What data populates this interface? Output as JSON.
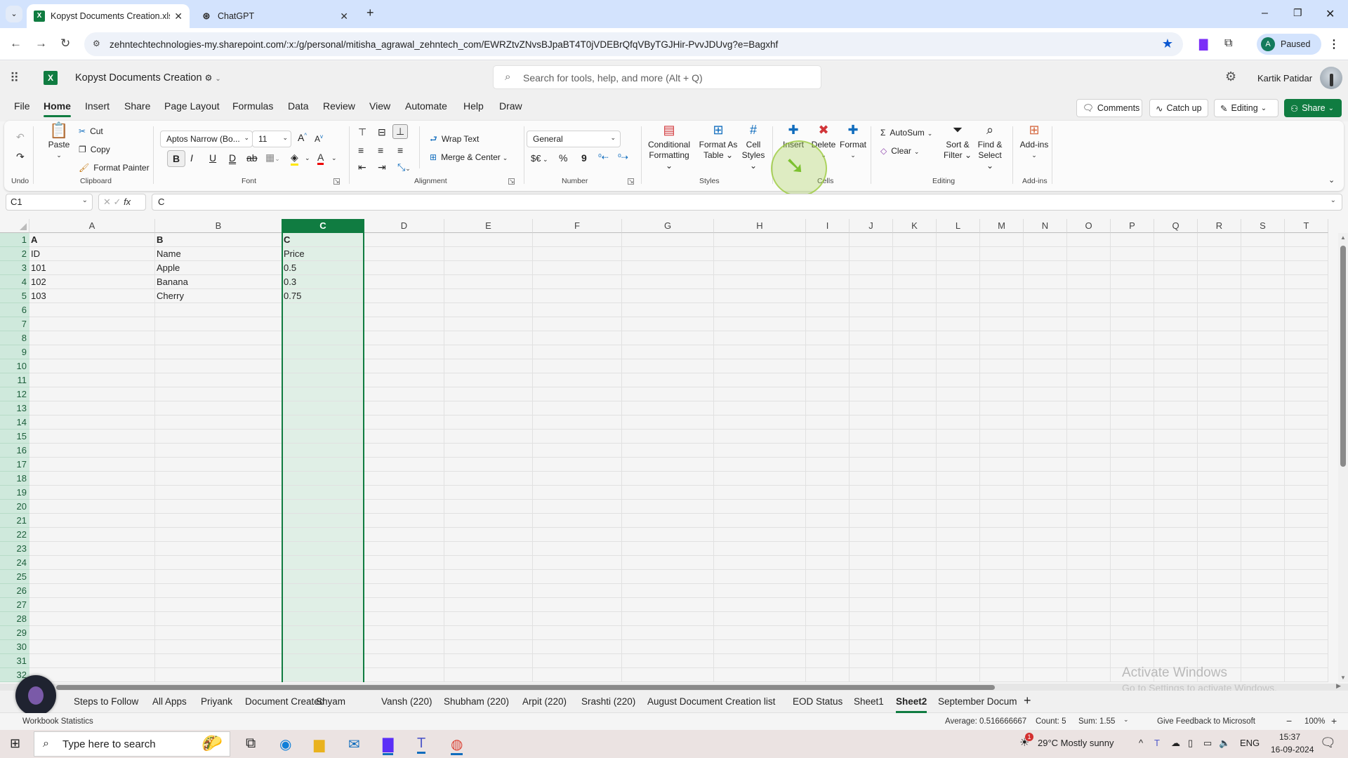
{
  "browser": {
    "tabs": [
      {
        "title": "Kopyst Documents Creation.xlsx",
        "active": true,
        "icon": "excel-icon"
      },
      {
        "title": "ChatGPT",
        "active": false,
        "icon": "chatgpt-icon"
      }
    ],
    "new_tab": "+",
    "url": "zehntechtechnologies-my.sharepoint.com/:x:/g/personal/mitisha_agrawal_zehntech_com/EWRZtvZNvsBJpaBT4T0jVDEBrQfqVByTGJHir-PvvJDUvg?e=Bagxhf",
    "profile_initial": "A",
    "profile_status": "Paused",
    "window_controls": {
      "minimize": "–",
      "restore": "❐",
      "close": "✕"
    }
  },
  "app": {
    "doc_title": "Kopyst Documents Creation",
    "search_placeholder": "Search for tools, help, and more (Alt + Q)",
    "user_name": "Kartik Patidar"
  },
  "menu": {
    "tabs": [
      "File",
      "Home",
      "Insert",
      "Share",
      "Page Layout",
      "Formulas",
      "Data",
      "Review",
      "View",
      "Automate",
      "Help",
      "Draw"
    ],
    "active": "Home",
    "comments": "Comments",
    "catch_up": "Catch up",
    "editing": "Editing",
    "share": "Share"
  },
  "ribbon": {
    "undo_group": "Undo",
    "clipboard": {
      "paste": "Paste",
      "cut": "Cut",
      "copy": "Copy",
      "format_painter": "Format Painter",
      "label": "Clipboard"
    },
    "font": {
      "name": "Aptos Narrow (Bo...",
      "size": "11",
      "label": "Font",
      "bold": "B",
      "italic": "I",
      "underline": "U",
      "double_underline": "D"
    },
    "alignment": {
      "wrap_text": "Wrap Text",
      "merge_center": "Merge & Center",
      "label": "Alignment"
    },
    "number": {
      "format": "General",
      "currency": "$€",
      "percent": "%",
      "comma": "9",
      "label": "Number"
    },
    "styles": {
      "conditional_1": "Conditional",
      "conditional_2": "Formatting",
      "format_table_1": "Format As",
      "format_table_2": "Table",
      "cell_styles_1": "Cell",
      "cell_styles_2": "Styles",
      "label": "Styles"
    },
    "cells": {
      "insert": "Insert",
      "delete": "Delete",
      "format": "Format",
      "label": "Cells"
    },
    "editing": {
      "autosum": "AutoSum",
      "clear": "Clear",
      "sort_1": "Sort &",
      "sort_2": "Filter",
      "find_1": "Find &",
      "find_2": "Select",
      "label": "Editing"
    },
    "addins": {
      "button": "Add-ins",
      "label": "Add-ins"
    }
  },
  "formula_bar": {
    "name_box": "C1",
    "fx": "fx",
    "content": "C"
  },
  "sheet": {
    "columns": [
      "A",
      "B",
      "C",
      "D",
      "E",
      "F",
      "G",
      "H",
      "I",
      "J",
      "K",
      "L",
      "M",
      "N",
      "O",
      "P",
      "Q",
      "R",
      "S",
      "T"
    ],
    "selected_column": "C",
    "row_count": 32,
    "rows": [
      [
        "A",
        "B",
        "C"
      ],
      [
        "ID",
        "Name",
        "Price"
      ],
      [
        "101",
        "Apple",
        "0.5"
      ],
      [
        "102",
        "Banana",
        "0.3"
      ],
      [
        "103",
        "Cherry",
        "0.75"
      ]
    ]
  },
  "sheet_tabs": [
    "Steps to Follow",
    "All Apps",
    "Priyank",
    "Document Created",
    "Shyam",
    "Vansh (220)",
    "Shubham (220)",
    "Arpit (220)",
    "Srashti (220)",
    "August Document Creation list",
    "EOD Status",
    "Sheet1",
    "Sheet2",
    "September Docum"
  ],
  "active_sheet": "Sheet2",
  "status_bar": {
    "left": "Workbook Statistics",
    "average": "Average: 0.516666667",
    "count": "Count: 5",
    "sum": "Sum: 1.55",
    "feedback": "Give Feedback to Microsoft",
    "zoom": "100%"
  },
  "watermark": {
    "line1": "Activate Windows",
    "line2": "Go to Settings to activate Windows."
  },
  "taskbar": {
    "search_placeholder": "Type here to search",
    "weather": "29°C  Mostly sunny",
    "weather_badge": "1",
    "lang": "ENG",
    "time": "15:37",
    "date": "16-09-2024"
  },
  "colors": {
    "excel_green": "#107c41",
    "selection_fill": "#e0efe6",
    "row_header_sel": "#cfe9dc",
    "browser_blue": "#d3e3fd"
  }
}
